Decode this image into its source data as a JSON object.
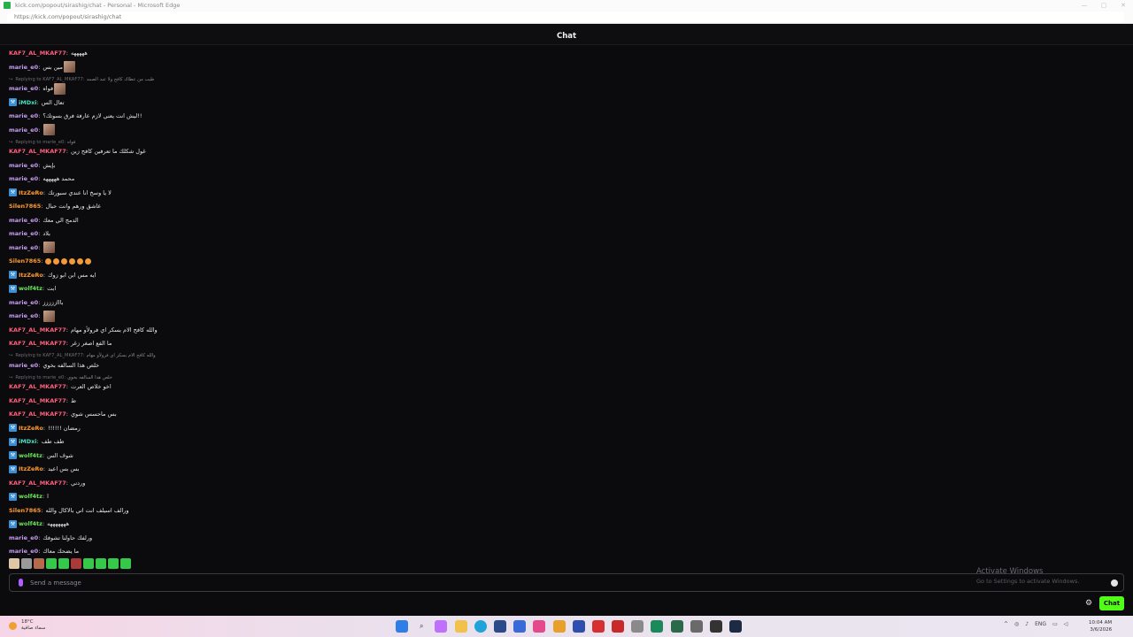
{
  "window": {
    "title": "kick.com/popout/sirashig/chat - Personal - Microsoft Edge",
    "url": "https://kick.com/popout/sirashig/chat"
  },
  "header": {
    "title": "Chat"
  },
  "colors": {
    "pink": "#ff5e7e",
    "purple": "#c69cf0",
    "orange": "#ff9a2e",
    "green": "#6be35a",
    "blue": "#5fb8ff",
    "teal": "#46e2c2",
    "accent": "#53fc18"
  },
  "messages": [
    {
      "user": "KAF7_AL_MKAF77",
      "color": "#ff5e7e",
      "text": "هههههه"
    },
    {
      "user": "marie_e0",
      "color": "#c69cf0",
      "text": "مين بس",
      "emote": true
    },
    {
      "user": "marie_e0",
      "color": "#c69cf0",
      "text": "فواه",
      "emote": true,
      "reply_to": "KAF7_AL_MKAF77",
      "reply_text": "طيب من عطاك كافح ولا عبد الصمد"
    },
    {
      "user": "iMDxi",
      "color": "#46e2c2",
      "text": "تعال الس",
      "badge": true
    },
    {
      "user": "marie_e0",
      "color": "#c69cf0",
      "text": "!!ليش انت يعني لازم عارفة فرق بسوتك؟"
    },
    {
      "user": "marie_e0",
      "color": "#c69cf0",
      "text": "",
      "emote": true
    },
    {
      "user": "KAF7_AL_MKAF77",
      "color": "#ff5e7e",
      "text": "غول شكلك ما تعرفين كافح زين",
      "reply_to": "marie_e0",
      "reply_text": "فواه"
    },
    {
      "user": "marie_e0",
      "color": "#c69cf0",
      "text": "بإيش"
    },
    {
      "user": "marie_e0",
      "color": "#c69cf0",
      "text": "محمد هههههه"
    },
    {
      "user": "ItzZeRo",
      "color": "#ff9a2e",
      "text": "لا يا وسخ انا عندي سبورتك",
      "badge": true
    },
    {
      "user": "Silen7865",
      "color": "#ff9a2e",
      "text": "عاشق ورهم وانت حبال"
    },
    {
      "user": "marie_e0",
      "color": "#c69cf0",
      "text": "الدمج الي معك"
    },
    {
      "user": "marie_e0",
      "color": "#c69cf0",
      "text": "بلاد"
    },
    {
      "user": "marie_e0",
      "color": "#c69cf0",
      "text": "",
      "emote": true
    },
    {
      "user": "Silen7865",
      "color": "#ff9a2e",
      "text": "",
      "emos": 6
    },
    {
      "user": "ItzZeRo",
      "color": "#ff9a2e",
      "text": "ايه مس ابن ابو زوك",
      "badge": true
    },
    {
      "user": "wolf4tz",
      "color": "#6be35a",
      "text": "ابت",
      "badge": true
    },
    {
      "user": "marie_e0",
      "color": "#c69cf0",
      "text": "باااززززز"
    },
    {
      "user": "marie_e0",
      "color": "#c69cf0",
      "text": "",
      "emote": true
    },
    {
      "user": "KAF7_AL_MKAF77",
      "color": "#ff5e7e",
      "text": "والله كافح الام بسكر اي فرولأو مهام"
    },
    {
      "user": "KAF7_AL_MKAF77",
      "color": "#ff5e7e",
      "text": "ما الفع اصغر زغر"
    },
    {
      "user": "marie_e0",
      "color": "#c69cf0",
      "text": "خلص هذا السالفه بخوي",
      "reply_to": "KAF7_AL_MKAF77",
      "reply_text": "والله كافح الام بسكر اي فرولأو مهام"
    },
    {
      "user": "KAF7_AL_MKAF77",
      "color": "#ff5e7e",
      "text": "اخو خلاص العرت",
      "reply_to": "marie_e0",
      "reply_text": "خلص هذا السالفه بخوي"
    },
    {
      "user": "KAF7_AL_MKAF77",
      "color": "#ff5e7e",
      "text": "ط"
    },
    {
      "user": "KAF7_AL_MKAF77",
      "color": "#ff5e7e",
      "text": "بس ماحسس شوي"
    },
    {
      "user": "ItzZeRo",
      "color": "#ff9a2e",
      "text": "رمضان !!!!!!",
      "badge": true
    },
    {
      "user": "iMDxi",
      "color": "#46e2c2",
      "text": "طف طف",
      "badge": true
    },
    {
      "user": "wolf4tz",
      "color": "#6be35a",
      "text": "شوف الس",
      "badge": true
    },
    {
      "user": "ItzZeRo",
      "color": "#ff9a2e",
      "text": "بس بس اعيد",
      "badge": true
    },
    {
      "user": "KAF7_AL_MKAF77",
      "color": "#ff5e7e",
      "text": "وردني"
    },
    {
      "user": "wolf4tz",
      "color": "#6be35a",
      "text": "ا",
      "badge": true
    },
    {
      "user": "Silen7865",
      "color": "#ff9a2e",
      "text": "ورالف اسيلف انت اتي بالاكال والله"
    },
    {
      "user": "wolf4tz",
      "color": "#6be35a",
      "text": "هههههههه",
      "badge": true
    },
    {
      "user": "marie_e0",
      "color": "#c69cf0",
      "text": "ورلفك حاولنا تشوفك"
    },
    {
      "user": "marie_e0",
      "color": "#c69cf0",
      "text": "ما يضحك معاك"
    }
  ],
  "emote_bar": [
    "#e0c8a6",
    "#9a9a9a",
    "#b56b4b",
    "#35c84a",
    "#35c84a",
    "#a83a3a",
    "#35c84a",
    "#35c84a",
    "#35c84a",
    "#35c84a"
  ],
  "input": {
    "placeholder": "Send a message"
  },
  "activate": {
    "line1": "Activate Windows",
    "line2": "Go to Settings to activate Windows."
  },
  "chat_button": "Chat",
  "taskbar": {
    "weather_temp": "18°C",
    "weather_desc": "سماء صافية",
    "lang": "ENG",
    "time": "10:04 AM",
    "date": "3/6/2026"
  }
}
